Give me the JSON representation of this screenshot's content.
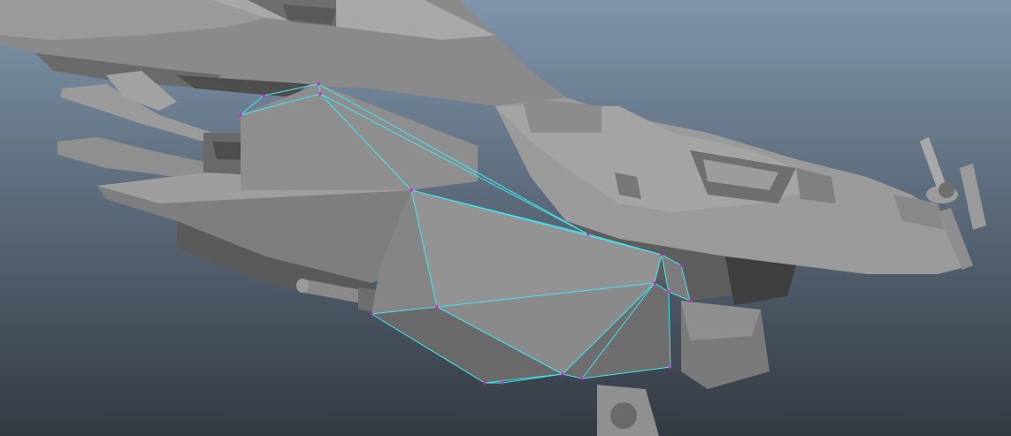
{
  "viewport": {
    "background_top": "#7f94aa",
    "background_bottom": "#333a42"
  },
  "model": {
    "wireframe_color": "#40e6f0",
    "vertex_color": "#d020d0"
  }
}
